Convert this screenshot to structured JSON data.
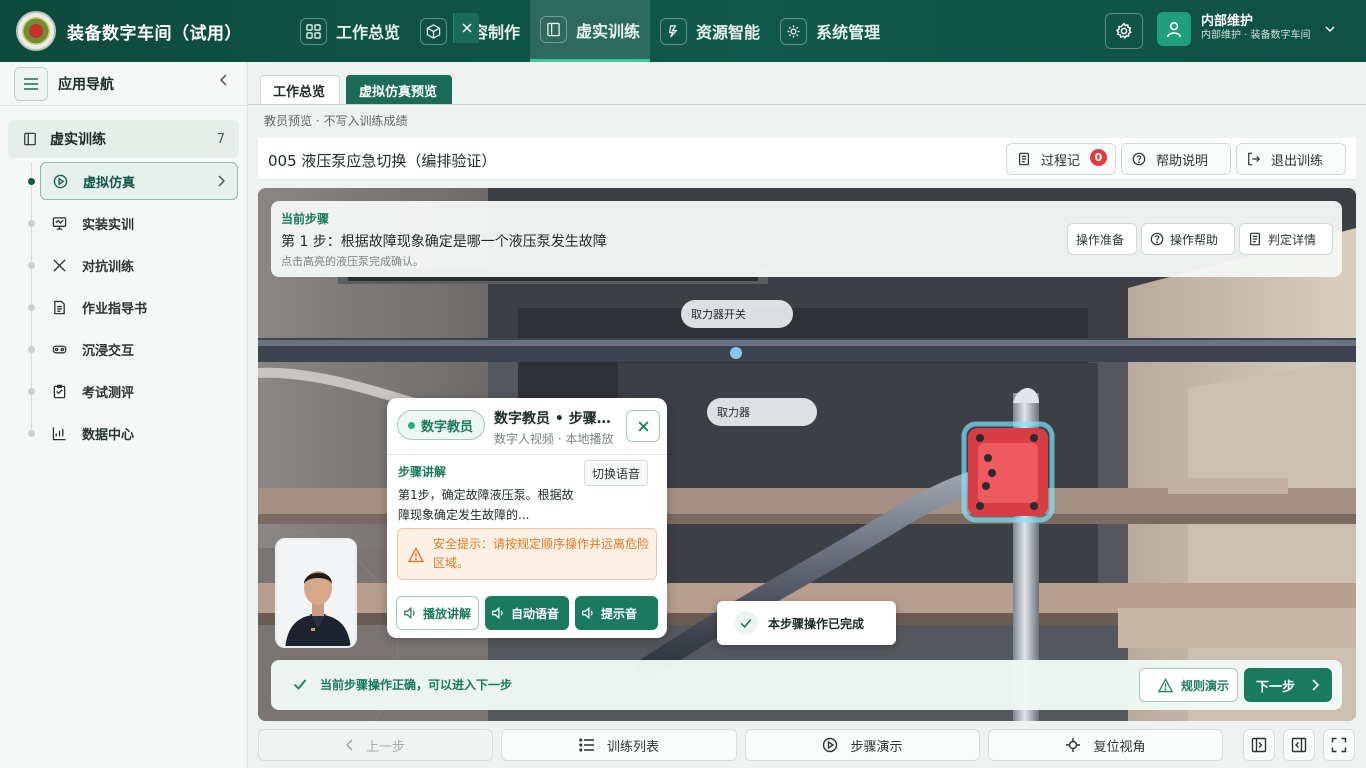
{
  "app": {
    "title": "装备数字车间（试用）"
  },
  "nav": [
    {
      "label": "工作总览",
      "icon": "grid-icon"
    },
    {
      "label": "内容制作",
      "icon": "cube-icon"
    },
    {
      "label": "虚实训练",
      "icon": "book-icon",
      "active": true
    },
    {
      "label": "资源智能",
      "icon": "lightning-icon"
    },
    {
      "label": "系统管理",
      "icon": "gear-icon"
    }
  ],
  "user": {
    "name": "内部维护",
    "sub": "内部维护 · 装备数字车间"
  },
  "sidebar": {
    "title": "应用导航",
    "group": {
      "label": "虚实训练",
      "count": "7"
    },
    "items": [
      {
        "label": "虚拟仿真",
        "icon": "play-circle-icon",
        "active": true
      },
      {
        "label": "实装实训",
        "icon": "monitor-icon"
      },
      {
        "label": "对抗训练",
        "icon": "swords-icon"
      },
      {
        "label": "作业指导书",
        "icon": "document-icon"
      },
      {
        "label": "沉浸交互",
        "icon": "vr-headset-icon"
      },
      {
        "label": "考试测评",
        "icon": "clipboard-icon"
      },
      {
        "label": "数据中心",
        "icon": "chart-icon"
      }
    ]
  },
  "tabs": [
    {
      "label": "工作总览"
    },
    {
      "label": "虚拟仿真预览",
      "active": true
    }
  ],
  "sub_note": "教员预览 · 不写入训练成绩",
  "page": {
    "title": "005 液压泵应急切换（编排验证）",
    "buttons": {
      "log": "过程记",
      "log_badge": "0",
      "help": "帮助说明",
      "exit": "退出训练"
    }
  },
  "step": {
    "head": "当前步骤",
    "title": "第 1 步：根据故障现象确定是哪一个液压泵发生故障",
    "hint": "点击高亮的液压泵完成确认。",
    "buttons": {
      "prepare": "操作准备",
      "help": "操作帮助",
      "judge": "判定详情"
    }
  },
  "scene_labels": {
    "switch": "取力器开关",
    "pto": "取力器"
  },
  "tutor": {
    "badge": "数字教员",
    "name": "数字教员 • 步骤讲解",
    "sub": "数字人视频 · 本地播放",
    "section": "步骤讲解",
    "switch_voice": "切换语音",
    "text": "第1步，确定故障液压泵。根据故障现象确定发生故障的...",
    "warning": "安全提示：请按规定顺序操作并远离危险区域。",
    "buttons": {
      "play": "播放讲解",
      "auto": "自动语音",
      "tone": "提示音"
    }
  },
  "toast": "本步骤操作已完成",
  "status": {
    "text": "当前步骤操作正确，可以进入下一步",
    "rule": "规则演示",
    "next": "下一步"
  },
  "footer": {
    "prev": "上一步",
    "list": "训练列表",
    "demo": "步骤演示",
    "reset": "复位视角"
  },
  "colors": {
    "brand": "#11594a",
    "accent": "#1a7a5e",
    "warning": "#e27a28",
    "badge": "#e23b3b"
  }
}
